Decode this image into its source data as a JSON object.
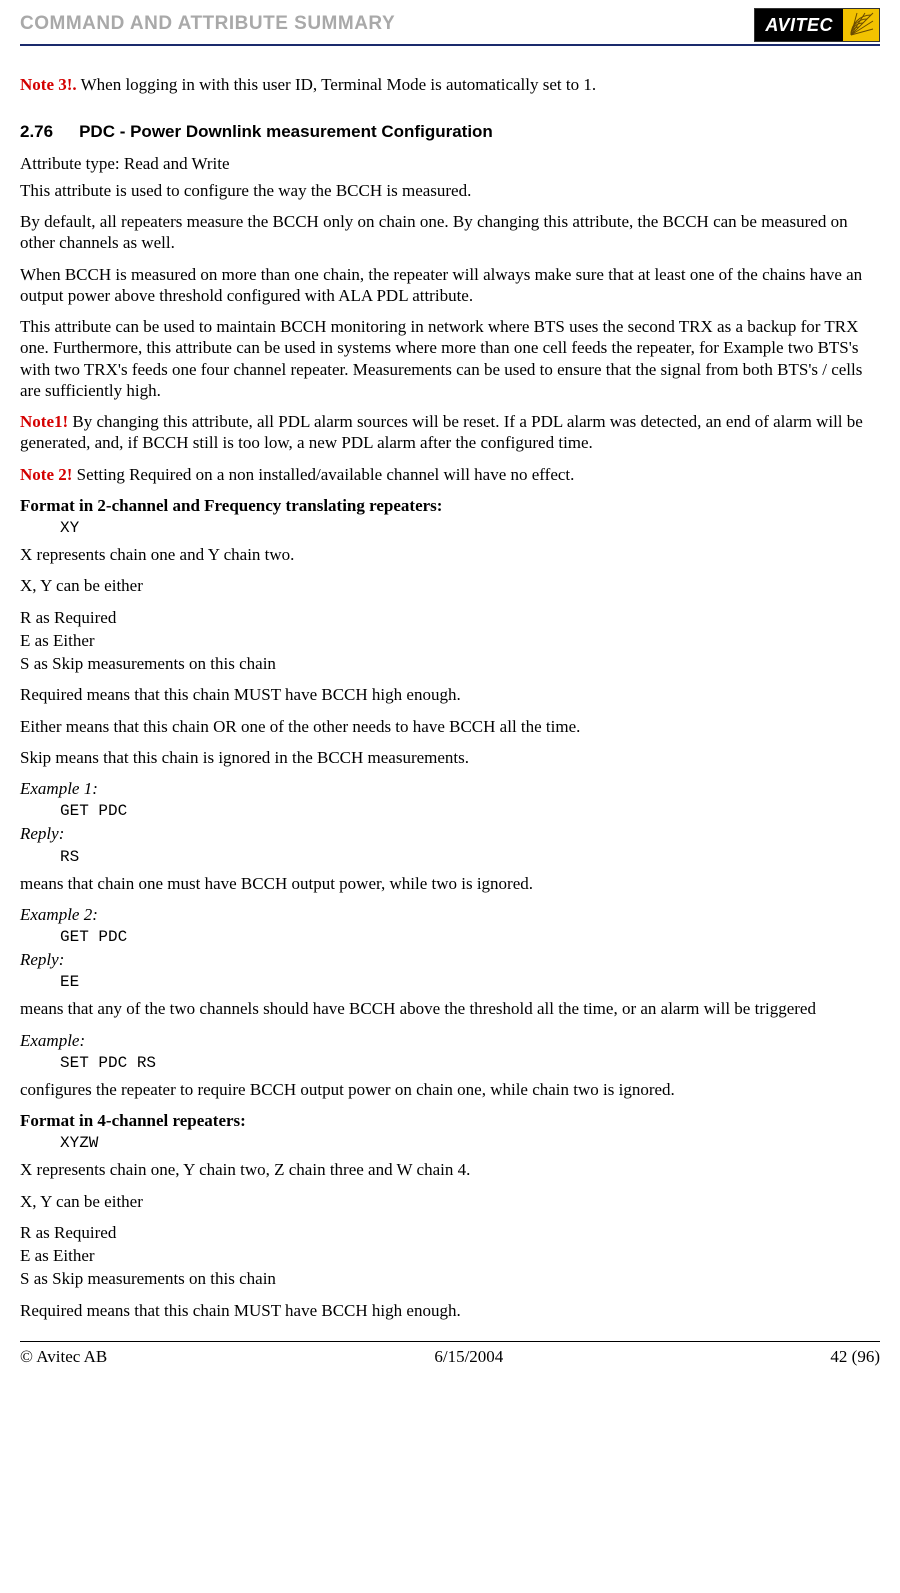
{
  "header": {
    "title": "COMMAND AND ATTRIBUTE SUMMARY",
    "logo_text": "AVITEC"
  },
  "note3": {
    "label": "Note 3!.",
    "text": " When logging in with this user ID, Terminal Mode is automatically set to 1."
  },
  "section": {
    "number": "2.76",
    "title": "PDC - Power Downlink measurement Configuration"
  },
  "body": {
    "attr_type": "Attribute type: Read and Write",
    "p1": "This attribute is used to configure the way the BCCH is measured.",
    "p2": "By default, all repeaters measure the BCCH only on chain one. By changing this attribute, the BCCH can be measured on other channels as well.",
    "p3": "When BCCH is measured on more than one chain, the repeater will always make sure that at least one of the chains have an output power above threshold configured with ALA PDL attribute.",
    "p4": "This attribute can be used to maintain BCCH monitoring in network where BTS uses the second TRX as a backup for TRX one. Furthermore, this attribute can be used in systems where more than one cell feeds the repeater, for Example two BTS's with two TRX's feeds one four channel repeater. Measurements can be used to ensure that the signal from both BTS's / cells are sufficiently high.",
    "note1": {
      "label": "Note1!",
      "text": " By changing this attribute, all PDL alarm sources will be reset. If a PDL alarm was detected, an end of alarm will be generated, and, if BCCH still is too low, a new PDL alarm after the configured time."
    },
    "note2": {
      "label": "Note 2!",
      "text": " Setting Required on a non installed/available channel will have no effect."
    },
    "format2_heading": "Format in 2-channel and Frequency translating repeaters:",
    "format2_code": "XY",
    "format2_desc": "X represents chain one and Y chain two.",
    "xy_either": "X, Y can be either",
    "r_line": "R as Required",
    "e_line": "E as Either",
    "s_line": "S as Skip measurements on this chain",
    "required_def": "Required means that this chain MUST have BCCH high enough.",
    "either_def": "Either means that this chain OR one of the other needs to have BCCH all the time.",
    "skip_def": "Skip means that this chain is ignored in the BCCH measurements.",
    "ex1_label": "Example 1:",
    "ex1_cmd": "GET PDC",
    "reply_label": "Reply:",
    "ex1_reply": "RS",
    "ex1_meaning": "means that chain one must have BCCH output power, while two is ignored.",
    "ex2_label": "Example 2:",
    "ex2_cmd": "GET PDC",
    "ex2_reply": "EE",
    "ex2_meaning": "means that any of the two channels should have BCCH above the threshold all the time, or an alarm will be triggered",
    "ex3_label": "Example:",
    "ex3_cmd": "SET PDC RS",
    "ex3_meaning": "configures the repeater to require BCCH output power on chain one, while chain two is ignored.",
    "format4_heading": "Format in 4-channel repeaters:",
    "format4_code": "XYZW",
    "format4_desc": "X represents chain one, Y chain two, Z chain three and W chain 4.",
    "xy_either2": "X, Y can be either",
    "r_line2": "R as Required",
    "e_line2": "E as Either",
    "s_line2": "S as Skip measurements on this chain",
    "required_def2": "Required means that this chain MUST have BCCH high enough."
  },
  "footer": {
    "copyright": "© Avitec AB",
    "date": "6/15/2004",
    "page": "42 (96)"
  }
}
